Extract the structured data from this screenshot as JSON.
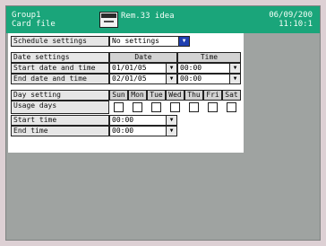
{
  "header": {
    "group": "Group1",
    "file": "Card file",
    "card_small": "",
    "card_status": "Rem.33 idea",
    "date": "06/09/200",
    "time": "11:10:1"
  },
  "schedule": {
    "label": "Schedule settings",
    "value": "No settings"
  },
  "date_settings": {
    "label": "Date settings",
    "col_date": "Date",
    "col_time": "Time",
    "start": {
      "label": "Start date and time",
      "date": "01/01/05",
      "time": "00:00"
    },
    "end": {
      "label": "End date and time",
      "date": "02/01/05",
      "time": "00:00"
    }
  },
  "day_settings": {
    "label": "Day setting",
    "days": [
      "Sun",
      "Mon",
      "Tue",
      "Wed",
      "Thu",
      "Fri",
      "Sat"
    ],
    "usage_label": "Usage days",
    "start_time_label": "Start time",
    "start_time": "00:00",
    "end_time_label": "End time",
    "end_time": "00:00"
  },
  "icons": {
    "card": "card-icon",
    "dropdown": "triangle-down"
  },
  "colors": {
    "titlebar": "#1aa57a",
    "selection": "#1f3fb0"
  }
}
